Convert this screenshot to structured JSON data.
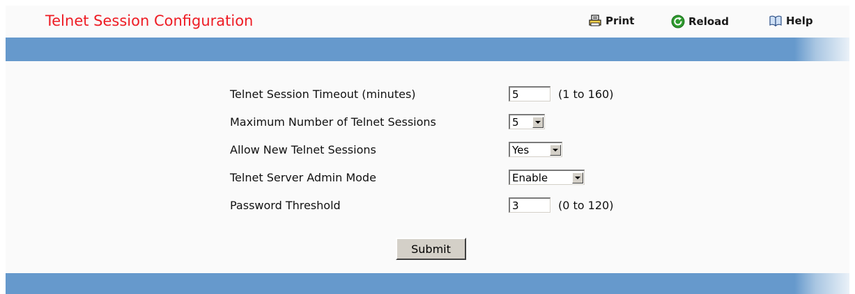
{
  "header": {
    "title": "Telnet Session Configuration",
    "print_label": "Print",
    "reload_label": "Reload",
    "help_label": "Help"
  },
  "colors": {
    "title": "#ee1c24",
    "bar": "#6699cc",
    "background": "#fafafa"
  },
  "form": {
    "timeout": {
      "label": "Telnet Session Timeout (minutes)",
      "value": "5",
      "hint": "(1 to 160)"
    },
    "max_sessions": {
      "label": "Maximum Number of Telnet Sessions",
      "value": "5"
    },
    "allow_new": {
      "label": "Allow New Telnet Sessions",
      "value": "Yes"
    },
    "admin_mode": {
      "label": "Telnet Server Admin Mode",
      "value": "Enable"
    },
    "password_threshold": {
      "label": "Password Threshold",
      "value": "3",
      "hint": "(0 to 120)"
    },
    "submit_label": "Submit"
  }
}
